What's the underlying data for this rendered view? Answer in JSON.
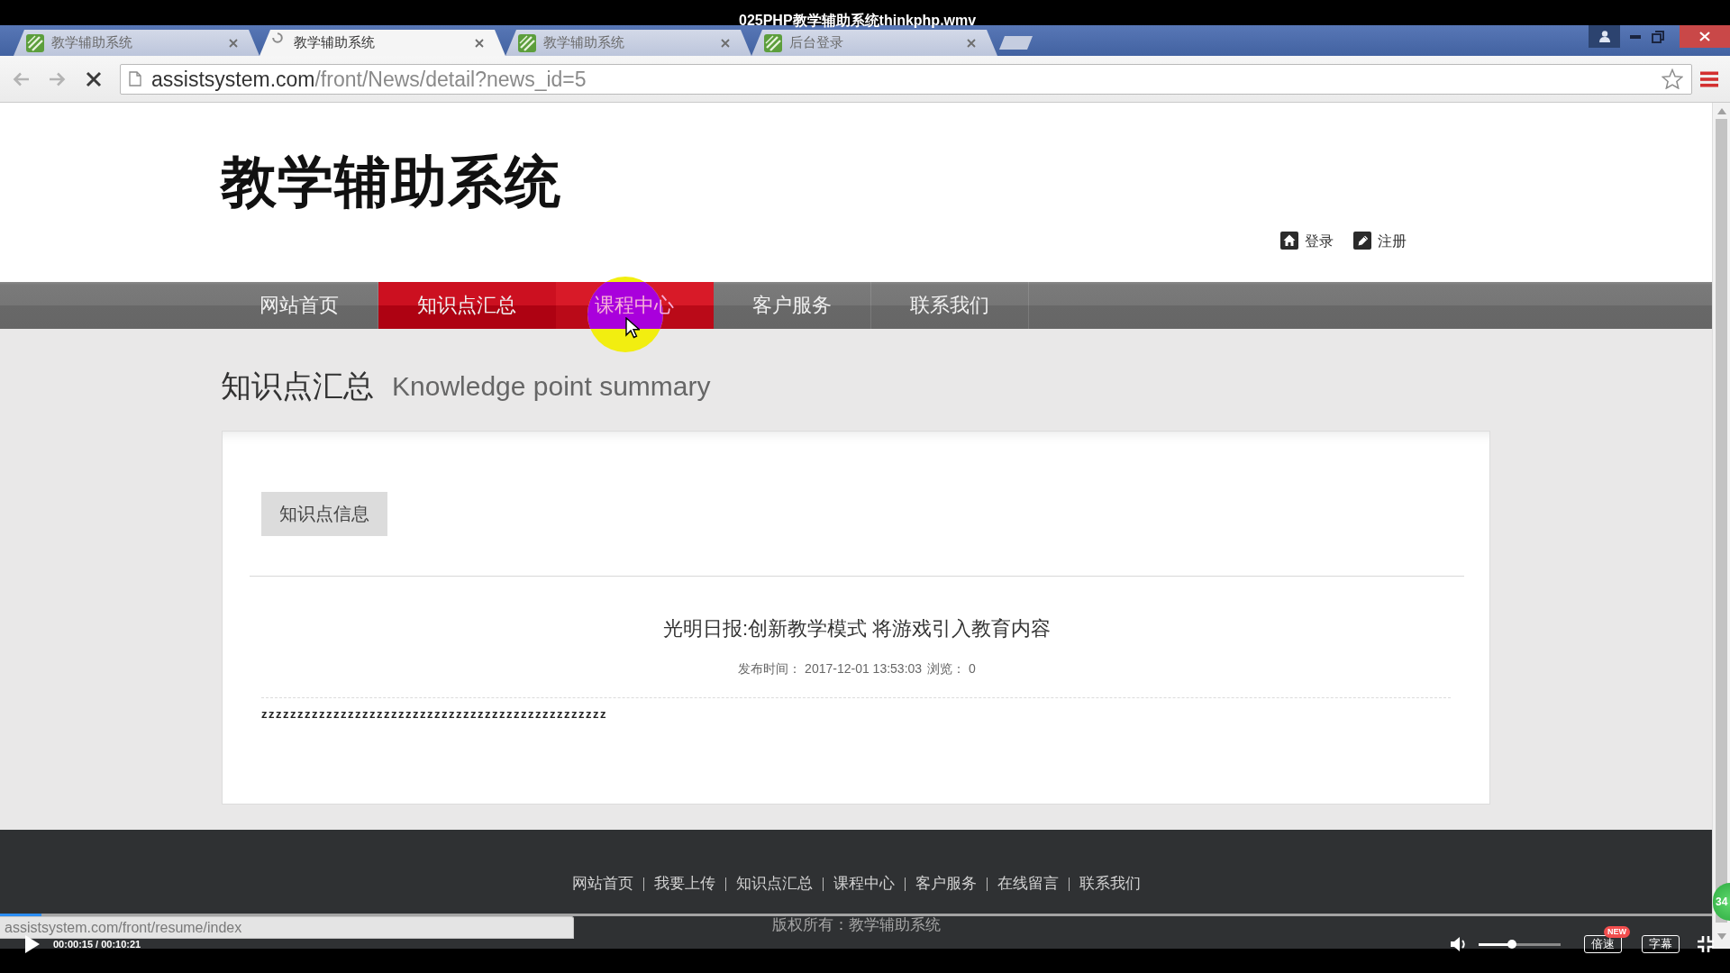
{
  "player": {
    "title": "025PHP教学辅助系统thinkphp.wmv",
    "time": "00:00:15 / 00:10:21",
    "progress": {
      "level": 0.024
    },
    "volume": {
      "level": 0.41
    },
    "buttons": [
      {
        "label": "倍速",
        "badge": "NEW"
      },
      {
        "label": "字幕"
      }
    ],
    "floating_badge": "34"
  },
  "browser": {
    "tabs": [
      {
        "title": "教学辅助系统",
        "selected": false,
        "loading": false
      },
      {
        "title": "教学辅助系统",
        "selected": true,
        "loading": true
      },
      {
        "title": "教学辅助系统",
        "selected": false,
        "loading": false
      },
      {
        "title": "后台登录",
        "selected": false,
        "loading": false
      }
    ],
    "url": {
      "host": "assistsystem.com",
      "path": "/front/News/detail?news_id=5"
    },
    "status_url": "assistsystem.com/front/resume/index"
  },
  "page": {
    "site_title": "教学辅助系统",
    "user_links": [
      {
        "kind": "login",
        "label": "登录"
      },
      {
        "kind": "register",
        "label": "注册"
      }
    ],
    "nav": [
      {
        "label": "网站首页",
        "selected": false,
        "hovered": false
      },
      {
        "label": "知识点汇总",
        "selected": true,
        "hovered": false
      },
      {
        "label": "课程中心",
        "selected": false,
        "hovered": true
      },
      {
        "label": "客户服务",
        "selected": false,
        "hovered": false
      },
      {
        "label": "联系我们",
        "selected": false,
        "hovered": false
      }
    ],
    "section": {
      "title": "知识点汇总",
      "subtitle": "Knowledge point summary"
    },
    "card": {
      "tab": "知识点信息",
      "article": {
        "title": "光明日报:创新教学模式 将游戏引入教育内容",
        "meta": [
          {
            "label": "发布时间：",
            "value": "2017-12-01 13:53:03"
          },
          {
            "label": "浏览：",
            "value": "0"
          }
        ],
        "body": "zzzzzzzzzzzzzzzzzzzzzzzzzzzzzzzzzzzzzzzzzzzzzzzz"
      }
    },
    "footer": {
      "links": [
        "网站首页",
        "我要上传",
        "知识点汇总",
        "课程中心",
        "客户服务",
        "在线留言",
        "联系我们"
      ],
      "copyright": "版权所有：教学辅助系统"
    }
  }
}
